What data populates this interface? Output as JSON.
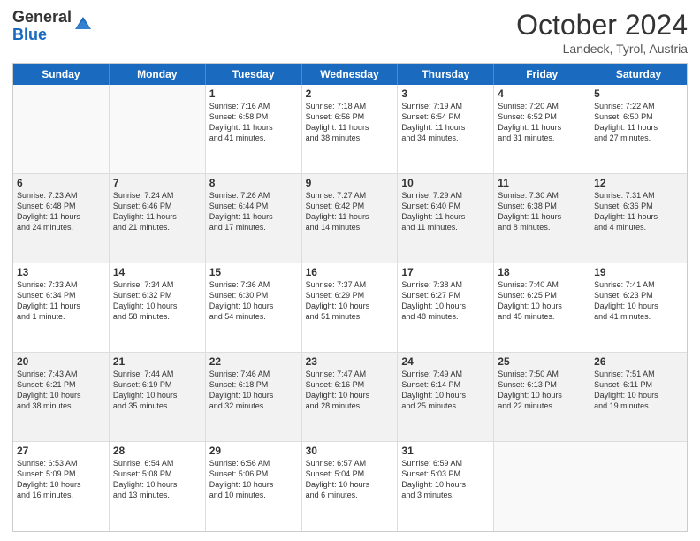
{
  "logo": {
    "general": "General",
    "blue": "Blue"
  },
  "header": {
    "month": "October 2024",
    "location": "Landeck, Tyrol, Austria"
  },
  "days": [
    "Sunday",
    "Monday",
    "Tuesday",
    "Wednesday",
    "Thursday",
    "Friday",
    "Saturday"
  ],
  "cells": [
    [
      {
        "day": "",
        "empty": true
      },
      {
        "day": "",
        "empty": true
      },
      {
        "day": "1",
        "line1": "Sunrise: 7:16 AM",
        "line2": "Sunset: 6:58 PM",
        "line3": "Daylight: 11 hours",
        "line4": "and 41 minutes."
      },
      {
        "day": "2",
        "line1": "Sunrise: 7:18 AM",
        "line2": "Sunset: 6:56 PM",
        "line3": "Daylight: 11 hours",
        "line4": "and 38 minutes."
      },
      {
        "day": "3",
        "line1": "Sunrise: 7:19 AM",
        "line2": "Sunset: 6:54 PM",
        "line3": "Daylight: 11 hours",
        "line4": "and 34 minutes."
      },
      {
        "day": "4",
        "line1": "Sunrise: 7:20 AM",
        "line2": "Sunset: 6:52 PM",
        "line3": "Daylight: 11 hours",
        "line4": "and 31 minutes."
      },
      {
        "day": "5",
        "line1": "Sunrise: 7:22 AM",
        "line2": "Sunset: 6:50 PM",
        "line3": "Daylight: 11 hours",
        "line4": "and 27 minutes."
      }
    ],
    [
      {
        "day": "6",
        "line1": "Sunrise: 7:23 AM",
        "line2": "Sunset: 6:48 PM",
        "line3": "Daylight: 11 hours",
        "line4": "and 24 minutes."
      },
      {
        "day": "7",
        "line1": "Sunrise: 7:24 AM",
        "line2": "Sunset: 6:46 PM",
        "line3": "Daylight: 11 hours",
        "line4": "and 21 minutes."
      },
      {
        "day": "8",
        "line1": "Sunrise: 7:26 AM",
        "line2": "Sunset: 6:44 PM",
        "line3": "Daylight: 11 hours",
        "line4": "and 17 minutes."
      },
      {
        "day": "9",
        "line1": "Sunrise: 7:27 AM",
        "line2": "Sunset: 6:42 PM",
        "line3": "Daylight: 11 hours",
        "line4": "and 14 minutes."
      },
      {
        "day": "10",
        "line1": "Sunrise: 7:29 AM",
        "line2": "Sunset: 6:40 PM",
        "line3": "Daylight: 11 hours",
        "line4": "and 11 minutes."
      },
      {
        "day": "11",
        "line1": "Sunrise: 7:30 AM",
        "line2": "Sunset: 6:38 PM",
        "line3": "Daylight: 11 hours",
        "line4": "and 8 minutes."
      },
      {
        "day": "12",
        "line1": "Sunrise: 7:31 AM",
        "line2": "Sunset: 6:36 PM",
        "line3": "Daylight: 11 hours",
        "line4": "and 4 minutes."
      }
    ],
    [
      {
        "day": "13",
        "line1": "Sunrise: 7:33 AM",
        "line2": "Sunset: 6:34 PM",
        "line3": "Daylight: 11 hours",
        "line4": "and 1 minute."
      },
      {
        "day": "14",
        "line1": "Sunrise: 7:34 AM",
        "line2": "Sunset: 6:32 PM",
        "line3": "Daylight: 10 hours",
        "line4": "and 58 minutes."
      },
      {
        "day": "15",
        "line1": "Sunrise: 7:36 AM",
        "line2": "Sunset: 6:30 PM",
        "line3": "Daylight: 10 hours",
        "line4": "and 54 minutes."
      },
      {
        "day": "16",
        "line1": "Sunrise: 7:37 AM",
        "line2": "Sunset: 6:29 PM",
        "line3": "Daylight: 10 hours",
        "line4": "and 51 minutes."
      },
      {
        "day": "17",
        "line1": "Sunrise: 7:38 AM",
        "line2": "Sunset: 6:27 PM",
        "line3": "Daylight: 10 hours",
        "line4": "and 48 minutes."
      },
      {
        "day": "18",
        "line1": "Sunrise: 7:40 AM",
        "line2": "Sunset: 6:25 PM",
        "line3": "Daylight: 10 hours",
        "line4": "and 45 minutes."
      },
      {
        "day": "19",
        "line1": "Sunrise: 7:41 AM",
        "line2": "Sunset: 6:23 PM",
        "line3": "Daylight: 10 hours",
        "line4": "and 41 minutes."
      }
    ],
    [
      {
        "day": "20",
        "line1": "Sunrise: 7:43 AM",
        "line2": "Sunset: 6:21 PM",
        "line3": "Daylight: 10 hours",
        "line4": "and 38 minutes."
      },
      {
        "day": "21",
        "line1": "Sunrise: 7:44 AM",
        "line2": "Sunset: 6:19 PM",
        "line3": "Daylight: 10 hours",
        "line4": "and 35 minutes."
      },
      {
        "day": "22",
        "line1": "Sunrise: 7:46 AM",
        "line2": "Sunset: 6:18 PM",
        "line3": "Daylight: 10 hours",
        "line4": "and 32 minutes."
      },
      {
        "day": "23",
        "line1": "Sunrise: 7:47 AM",
        "line2": "Sunset: 6:16 PM",
        "line3": "Daylight: 10 hours",
        "line4": "and 28 minutes."
      },
      {
        "day": "24",
        "line1": "Sunrise: 7:49 AM",
        "line2": "Sunset: 6:14 PM",
        "line3": "Daylight: 10 hours",
        "line4": "and 25 minutes."
      },
      {
        "day": "25",
        "line1": "Sunrise: 7:50 AM",
        "line2": "Sunset: 6:13 PM",
        "line3": "Daylight: 10 hours",
        "line4": "and 22 minutes."
      },
      {
        "day": "26",
        "line1": "Sunrise: 7:51 AM",
        "line2": "Sunset: 6:11 PM",
        "line3": "Daylight: 10 hours",
        "line4": "and 19 minutes."
      }
    ],
    [
      {
        "day": "27",
        "line1": "Sunrise: 6:53 AM",
        "line2": "Sunset: 5:09 PM",
        "line3": "Daylight: 10 hours",
        "line4": "and 16 minutes."
      },
      {
        "day": "28",
        "line1": "Sunrise: 6:54 AM",
        "line2": "Sunset: 5:08 PM",
        "line3": "Daylight: 10 hours",
        "line4": "and 13 minutes."
      },
      {
        "day": "29",
        "line1": "Sunrise: 6:56 AM",
        "line2": "Sunset: 5:06 PM",
        "line3": "Daylight: 10 hours",
        "line4": "and 10 minutes."
      },
      {
        "day": "30",
        "line1": "Sunrise: 6:57 AM",
        "line2": "Sunset: 5:04 PM",
        "line3": "Daylight: 10 hours",
        "line4": "and 6 minutes."
      },
      {
        "day": "31",
        "line1": "Sunrise: 6:59 AM",
        "line2": "Sunset: 5:03 PM",
        "line3": "Daylight: 10 hours",
        "line4": "and 3 minutes."
      },
      {
        "day": "",
        "empty": true
      },
      {
        "day": "",
        "empty": true
      }
    ]
  ]
}
